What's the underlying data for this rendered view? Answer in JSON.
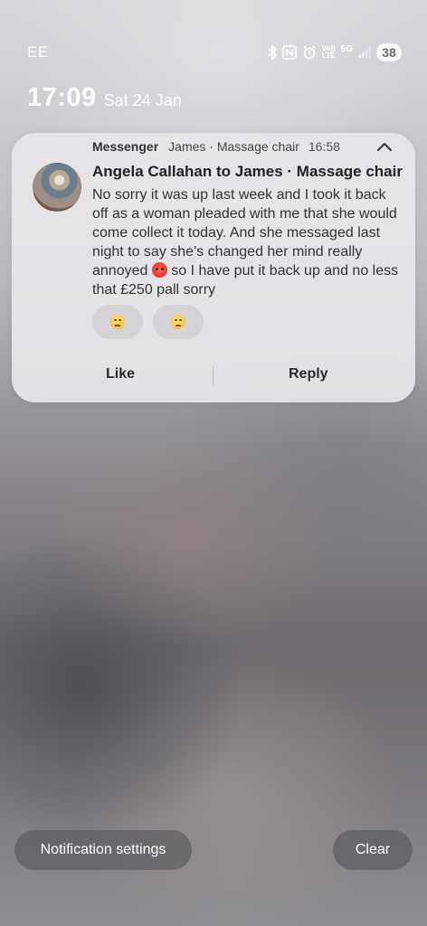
{
  "status_bar": {
    "carrier": "EE",
    "volte_label": "Vo))",
    "lte_label": "LTE",
    "fiveg_label": "5G",
    "battery": "38",
    "icons": [
      "bluetooth-icon",
      "nfc-icon",
      "alarm-icon",
      "volte-icon",
      "5g-icon",
      "signal-icon",
      "battery-icon"
    ]
  },
  "clock": {
    "time": "17:09",
    "date": "Sat 24 Jan"
  },
  "notification": {
    "app": "Messenger",
    "subtext": "James · Massage chair",
    "time": "16:58",
    "title": "Angela Callahan to James · Massage chair",
    "body_before_emoji": "No sorry it was up last week and I took it back off as a woman pleaded with me that she would come collect it today. And she messaged last night to say she's changed her mind really annoyed",
    "body_after_emoji": " so I have put it back up and no less that £250 pall sorry",
    "inline_emoji": "angry-face",
    "reactions": [
      "neutral-face",
      "disappointed-face"
    ],
    "actions": {
      "like": "Like",
      "reply": "Reply"
    }
  },
  "bottom": {
    "notification_settings": "Notification settings",
    "clear": "Clear"
  }
}
